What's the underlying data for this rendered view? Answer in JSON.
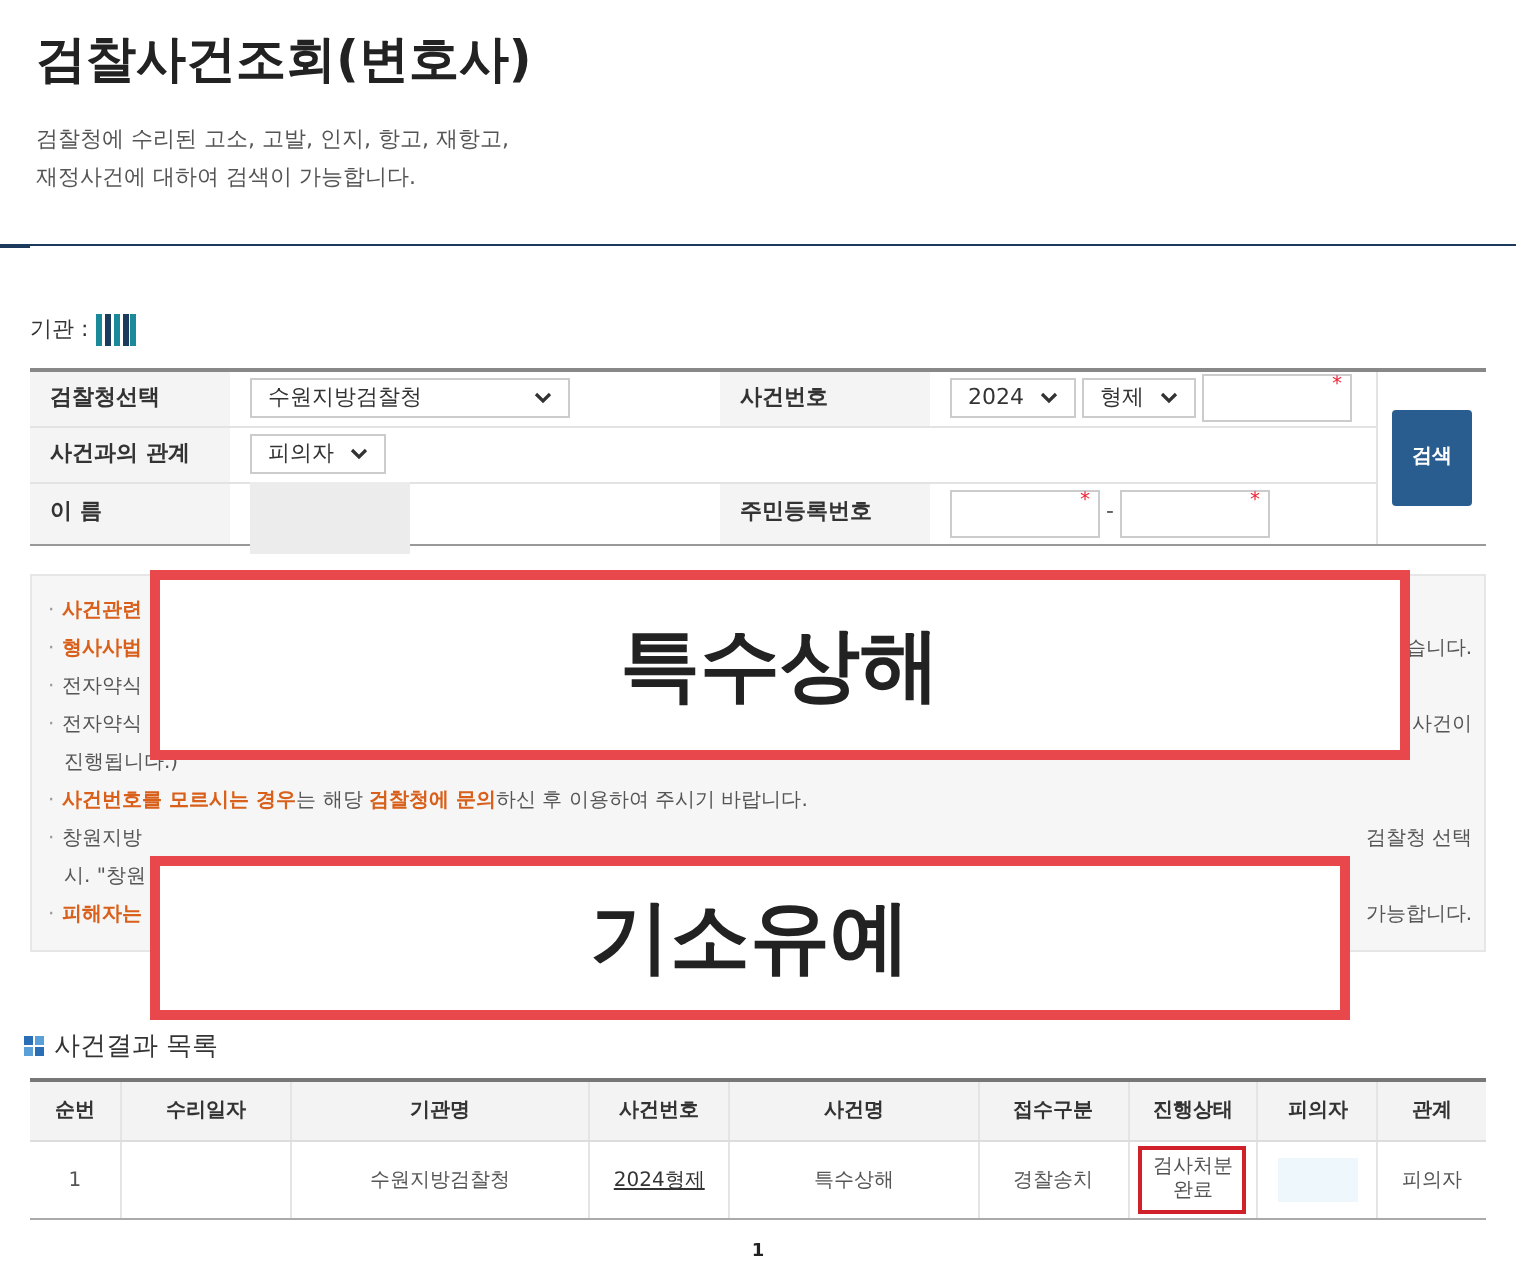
{
  "page": {
    "title": "검찰사건조회(변호사)",
    "description": [
      "검찰청에 수리된 고소, 고발, 인지, 항고, 재항고,",
      "재정사건에 대하여 검색이 가능합니다."
    ]
  },
  "agency_label": "기관 :",
  "form": {
    "rows": [
      {
        "cells": [
          {
            "kind": "label",
            "text": "검찰청선택"
          },
          {
            "kind": "select",
            "value": "수원지방검찰청",
            "wide": true
          },
          {
            "kind": "label",
            "text": "사건번호"
          },
          {
            "kind": "group",
            "items": [
              {
                "kind": "select",
                "value": "2024"
              },
              {
                "kind": "select",
                "value": "형제"
              },
              {
                "kind": "input",
                "required_mark": "*"
              }
            ]
          }
        ]
      },
      {
        "cells": [
          {
            "kind": "label",
            "text": "사건과의 관계"
          },
          {
            "kind": "select",
            "value": "피의자"
          }
        ]
      },
      {
        "cells": [
          {
            "kind": "label",
            "text": "이 름"
          },
          {
            "kind": "redacted"
          },
          {
            "kind": "label",
            "text": "주민등록번호"
          },
          {
            "kind": "group",
            "items": [
              {
                "kind": "input",
                "required_mark": "*"
              },
              {
                "kind": "sep",
                "text": "-"
              },
              {
                "kind": "input",
                "required_mark": "*"
              }
            ]
          }
        ]
      }
    ],
    "search_button": "검색"
  },
  "notice": [
    {
      "bullet": "·",
      "left": [
        {
          "text": "사건관련",
          "highlight": true
        }
      ]
    },
    {
      "bullet": "·",
      "left": [
        {
          "text": "형사사법",
          "highlight": true
        }
      ],
      "right": "습니다."
    },
    {
      "bullet": "·",
      "left": [
        {
          "text": "전자약식",
          "highlight": false
        }
      ]
    },
    {
      "bullet": "·",
      "left": [
        {
          "text": "전자약식",
          "highlight": false
        }
      ],
      "right": "사건이"
    },
    {
      "left": [
        {
          "text": "진행됩니다.)",
          "highlight": false
        }
      ],
      "continuation": true
    },
    {
      "bullet": "·",
      "left": [
        {
          "text": "사건번호를 모르시는 경우",
          "highlight": true
        },
        {
          "text": "는 해당 ",
          "highlight": false
        },
        {
          "text": "검찰청에 문의",
          "highlight": true
        },
        {
          "text": "하신 후 이용하여 주시기 바랍니다.",
          "highlight": false
        }
      ]
    },
    {
      "bullet": "·",
      "left": [
        {
          "text": "창원지방",
          "highlight": false
        }
      ],
      "right": "검찰청 선택"
    },
    {
      "left": [
        {
          "text": "시. \"창원",
          "highlight": false
        }
      ],
      "continuation": true
    },
    {
      "bullet": "·",
      "left": [
        {
          "text": "피해자는",
          "highlight": true
        }
      ],
      "right": "가능합니다."
    }
  ],
  "overlays": [
    "특수상해",
    "기소유예"
  ],
  "results": {
    "title": "사건결과 목록",
    "columns": [
      "순번",
      "수리일자",
      "기관명",
      "사건번호",
      "사건명",
      "접수구분",
      "진행상태",
      "피의자",
      "관계"
    ],
    "rows": [
      {
        "no": "1",
        "agency": "수원지방검찰청",
        "case_no": "2024형제",
        "case_name": "특수상해",
        "intake": "경찰송치",
        "status": "검사처분 완료",
        "status_flagged": true,
        "relation": "피의자"
      }
    ],
    "pages": [
      {
        "label": "1",
        "selected": true
      }
    ]
  }
}
